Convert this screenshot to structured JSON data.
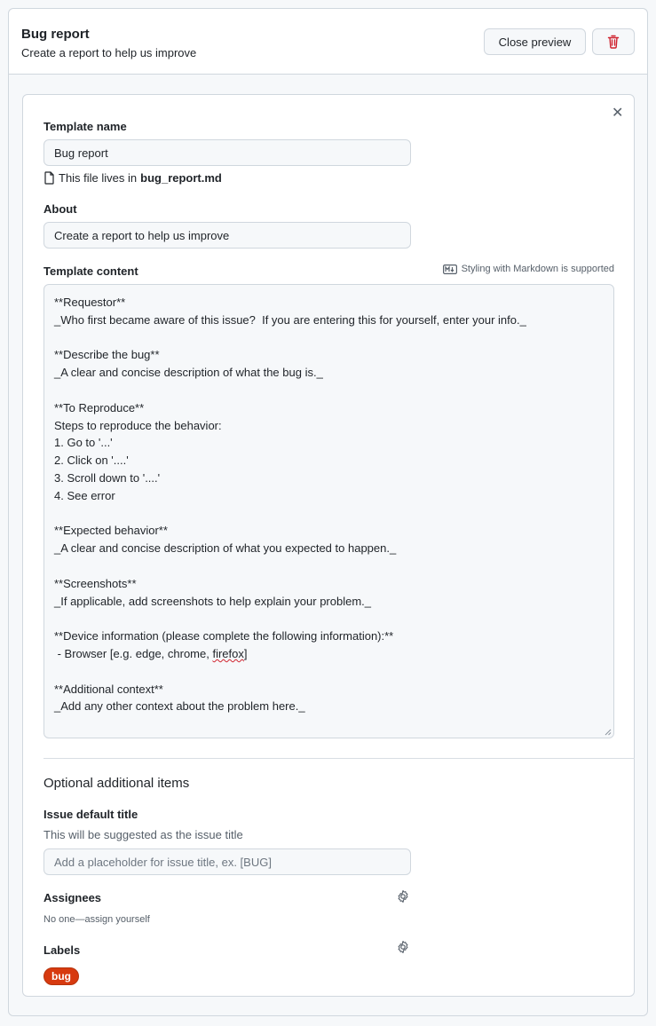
{
  "header": {
    "title": "Bug report",
    "subtitle": "Create a report to help us improve",
    "close_preview_label": "Close preview"
  },
  "form": {
    "template_name_label": "Template name",
    "template_name_value": "Bug report",
    "file_note_prefix": "This file lives in",
    "file_name": "bug_report.md",
    "about_label": "About",
    "about_value": "Create a report to help us improve",
    "content_label": "Template content",
    "markdown_note": "Styling with Markdown is supported",
    "content_lines": [
      "**Requestor**",
      "_Who first became aware of this issue?  If you are entering this for yourself, enter your info._",
      "",
      "**Describe the bug**",
      "_A clear and concise description of what the bug is._",
      "",
      "**To Reproduce**",
      "Steps to reproduce the behavior:",
      "1. Go to '...'",
      "2. Click on '....'",
      "3. Scroll down to '....'",
      "4. See error",
      "",
      "**Expected behavior**",
      "_A clear and concise description of what you expected to happen._",
      "",
      "**Screenshots**",
      "_If applicable, add screenshots to help explain your problem._",
      "",
      "**Device information (please complete the following information):**",
      " - Browser [e.g. edge, chrome, firefox]",
      "",
      "**Additional context**",
      "_Add any other context about the problem here._"
    ]
  },
  "optional": {
    "section_title": "Optional additional items",
    "issue_title_label": "Issue default title",
    "issue_title_help": "This will be suggested as the issue title",
    "issue_title_placeholder": "Add a placeholder for issue title, ex. [BUG]",
    "assignees_label": "Assignees",
    "assignees_value": "No one—assign yourself",
    "labels_label": "Labels",
    "labels": [
      {
        "name": "bug",
        "color": "#d73a0f"
      }
    ]
  },
  "icons": {
    "delete": "trash-icon",
    "close": "close-icon",
    "file": "file-icon",
    "markdown": "markdown-icon",
    "settings": "gear-icon"
  },
  "colors": {
    "danger": "#cf222e",
    "label_bug": "#d73a0f"
  }
}
